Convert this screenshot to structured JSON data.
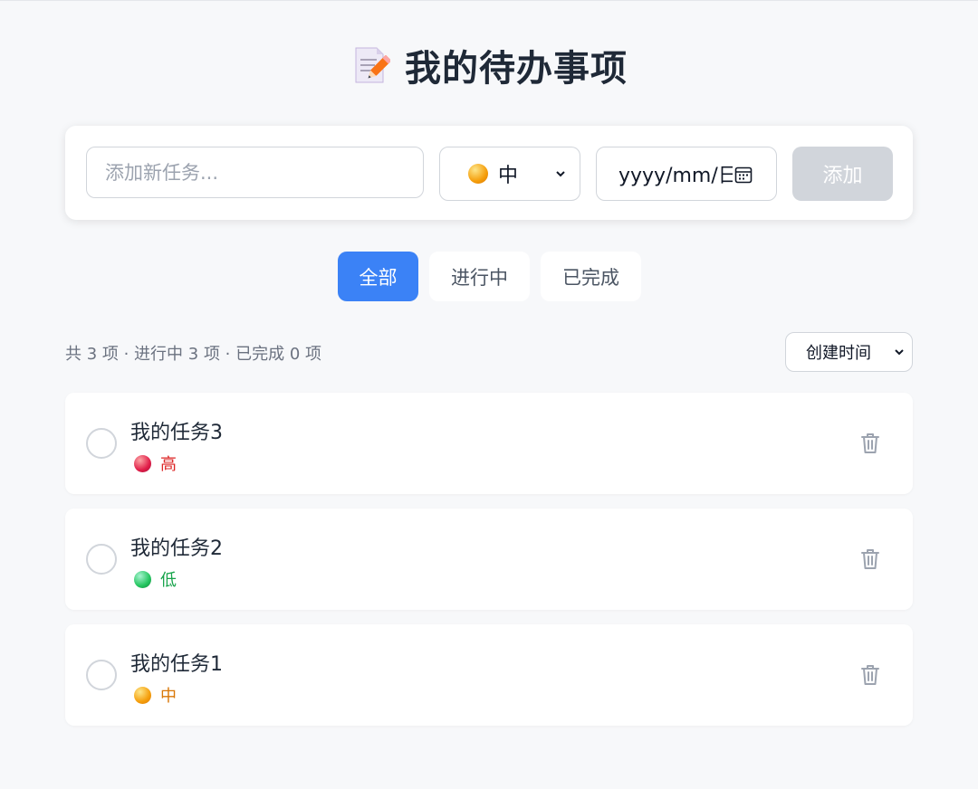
{
  "header": {
    "title": "我的待办事项",
    "icon": "memo-icon"
  },
  "form": {
    "task_placeholder": "添加新任务...",
    "priority_selected": "中",
    "date_placeholder": "yyyy/mm/日",
    "add_label": "添加"
  },
  "filters": {
    "tabs": [
      {
        "label": "全部",
        "active": true
      },
      {
        "label": "进行中",
        "active": false
      },
      {
        "label": "已完成",
        "active": false
      }
    ]
  },
  "stats": {
    "text": "共 3 项 · 进行中 3 项 · 已完成 0 项"
  },
  "sort": {
    "selected": "创建时间"
  },
  "tasks": [
    {
      "title": "我的任务3",
      "priority": "高",
      "priority_color": "#dc2626",
      "done": false
    },
    {
      "title": "我的任务2",
      "priority": "低",
      "priority_color": "#16a34a",
      "done": false
    },
    {
      "title": "我的任务1",
      "priority": "中",
      "priority_color": "#d97706",
      "done": false
    }
  ],
  "colors": {
    "accent": "#3b82f6",
    "high": "#dc2626",
    "medium": "#d97706",
    "low": "#16a34a",
    "disabled_button": "#d1d5db"
  }
}
